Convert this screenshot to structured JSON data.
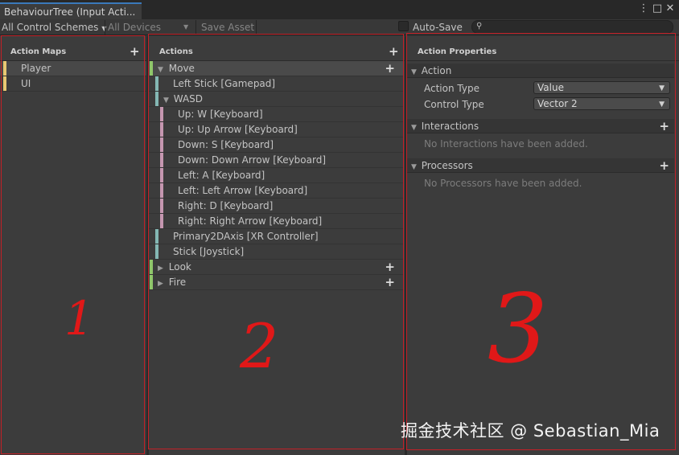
{
  "window": {
    "tab_title": "BehaviourTree (Input Acti...",
    "menu_icon": "⋮",
    "maximize_icon": "□",
    "close_icon": "✕"
  },
  "toolbar": {
    "control_schemes": "All Control Schemes",
    "devices": "All Devices",
    "save_asset": "Save Asset",
    "auto_save": "Auto-Save",
    "dropdown_arrow": "▼",
    "search_icon": "⚲"
  },
  "action_maps": {
    "header": "Action Maps",
    "add": "+",
    "items": [
      "Player",
      "UI"
    ],
    "color": "#e8c872"
  },
  "actions": {
    "header": "Actions",
    "add": "+",
    "move": "Move",
    "left_stick": "Left Stick [Gamepad]",
    "wasd": "WASD",
    "wasd_parts": [
      "Up: W [Keyboard]",
      "Up: Up Arrow [Keyboard]",
      "Down: S [Keyboard]",
      "Down: Down Arrow [Keyboard]",
      "Left: A [Keyboard]",
      "Left: Left Arrow [Keyboard]",
      "Right: D [Keyboard]",
      "Right: Right Arrow [Keyboard]"
    ],
    "primary2d": "Primary2DAxis [XR Controller]",
    "stick": "Stick [Joystick]",
    "look": "Look",
    "fire": "Fire",
    "expand_icon": "▼",
    "collapse_icon": "▶",
    "colors": {
      "action": "#8fc66a",
      "binding": "#84b8b4",
      "part": "#c596b0"
    }
  },
  "properties": {
    "header": "Action Properties",
    "action_section": "Action",
    "action_type_label": "Action Type",
    "action_type_value": "Value",
    "control_type_label": "Control Type",
    "control_type_value": "Vector 2",
    "interactions_section": "Interactions",
    "interactions_empty": "No Interactions have been added.",
    "processors_section": "Processors",
    "processors_empty": "No Processors have been added.",
    "add": "+"
  },
  "annotations": {
    "one": "1",
    "two": "2",
    "three": "3",
    "color": "#e01818"
  },
  "watermark": "掘金技术社区 @ Sebastian_Mia"
}
